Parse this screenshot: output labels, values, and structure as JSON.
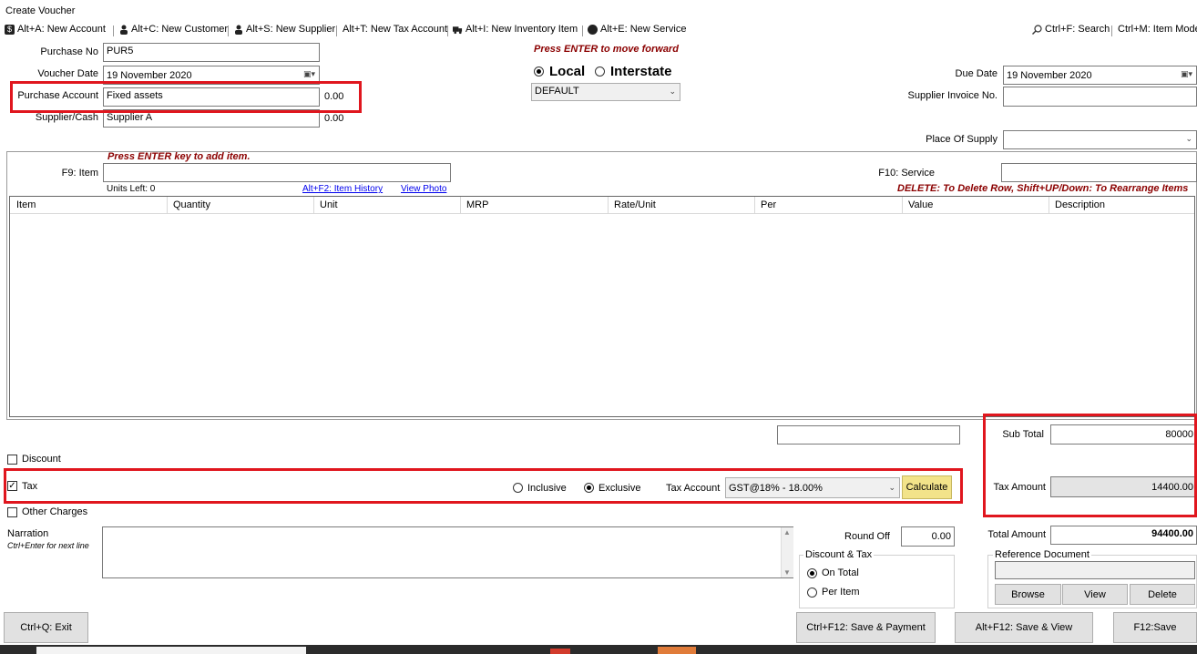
{
  "window": {
    "title": "Create Voucher"
  },
  "toolbar": {
    "items": [
      {
        "label": "Alt+A: New Account"
      },
      {
        "label": "Alt+C: New Customer"
      },
      {
        "label": "Alt+S: New Supplier"
      },
      {
        "label": "Alt+T: New Tax Account"
      },
      {
        "label": "Alt+I: New Inventory Item"
      },
      {
        "label": "Alt+E: New Service"
      }
    ],
    "search": "Ctrl+F: Search",
    "item_mode": "Ctrl+M: Item Mode"
  },
  "header": {
    "purchase_no_label": "Purchase No",
    "purchase_no": "PUR5",
    "voucher_date_label": "Voucher Date",
    "voucher_date": "19 November 2020",
    "purchase_account_label": "Purchase Account",
    "purchase_account": "Fixed assets",
    "purchase_account_balance": "0.00",
    "supplier_label": "Supplier/Cash",
    "supplier": "Supplier A",
    "supplier_balance": "0.00",
    "enter_hint": "Press ENTER to move forward",
    "local_label": "Local",
    "interstate_label": "Interstate",
    "tax_region": "DEFAULT",
    "due_date_label": "Due Date",
    "due_date": "19 November 2020",
    "supplier_invoice_label": "Supplier Invoice No.",
    "supplier_invoice": "",
    "place_of_supply_label": "Place Of Supply",
    "place_of_supply": ""
  },
  "items": {
    "add_hint": "Press ENTER key to add item.",
    "item_label": "F9: Item",
    "units_left": "Units Left: 0",
    "item_history_link": "Alt+F2: Item History",
    "view_photo_link": "View Photo",
    "service_label": "F10: Service",
    "delete_hint": "DELETE: To Delete Row, Shift+UP/Down: To Rearrange Items",
    "columns": [
      "Item",
      "Quantity",
      "Unit",
      "MRP",
      "Rate/Unit",
      "Per",
      "Value",
      "Description"
    ]
  },
  "totals": {
    "sub_total_label": "Sub Total",
    "sub_total": "80000",
    "tax_amount_label": "Tax Amount",
    "tax_amount": "14400.00",
    "total_amount_label": "Total Amount",
    "total_amount": "94400.00",
    "round_off_label": "Round Off",
    "round_off": "0.00"
  },
  "options": {
    "discount_label": "Discount",
    "tax_label": "Tax",
    "other_charges_label": "Other Charges",
    "inclusive_label": "Inclusive",
    "exclusive_label": "Exclusive",
    "tax_account_label": "Tax Account",
    "tax_account": "GST@18% - 18.00%",
    "calculate_label": "Calculate"
  },
  "narration": {
    "label": "Narration",
    "hint": "Ctrl+Enter for next line",
    "value": ""
  },
  "discount_tax": {
    "legend": "Discount & Tax",
    "on_total": "On Total",
    "per_item": "Per Item"
  },
  "reference": {
    "legend": "Reference Document",
    "browse": "Browse",
    "view": "View",
    "delete": "Delete"
  },
  "footer": {
    "exit": "Ctrl+Q: Exit",
    "save_payment": "Ctrl+F12: Save & Payment",
    "save_view": "Alt+F12: Save & View",
    "save": "F12:Save"
  },
  "colors": {
    "highlight": "#e0161e",
    "calculate_bg": "#f2e38a",
    "hint_text": "#8b0000"
  }
}
